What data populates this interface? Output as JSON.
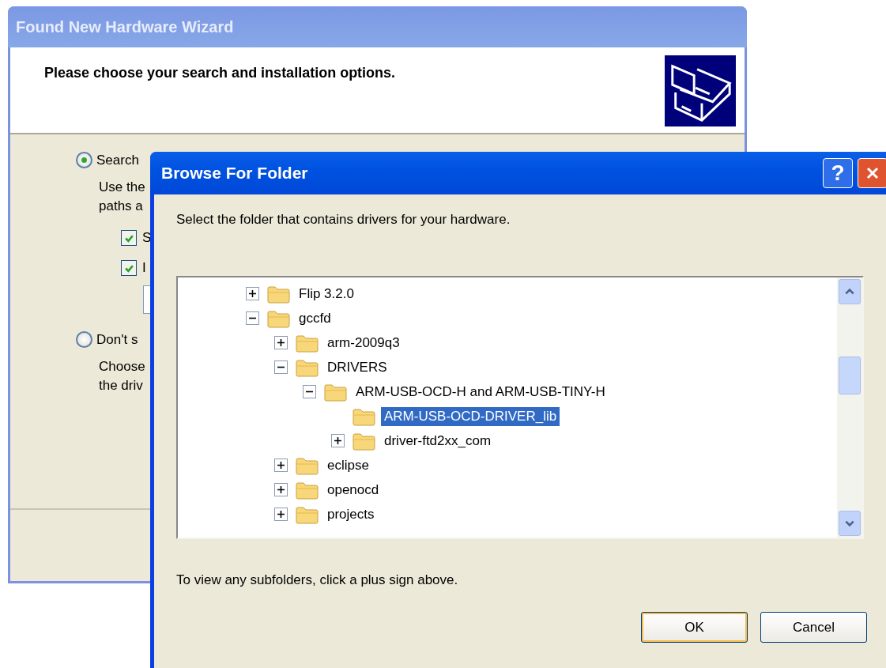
{
  "wizard": {
    "title": "Found New Hardware Wizard",
    "heading": "Please choose your search and installation options.",
    "options": [
      {
        "label": "Search",
        "selected": true,
        "description": [
          "Use the",
          "paths a"
        ],
        "checkboxes": [
          {
            "label": "S",
            "checked": true
          },
          {
            "label": "I",
            "checked": true
          }
        ]
      },
      {
        "label": "Don't s",
        "selected": false,
        "description": [
          "Choose",
          "the driv"
        ]
      }
    ]
  },
  "dialog": {
    "title": "Browse For Folder",
    "help_button": "?",
    "instruction": "Select the folder that contains drivers for your hardware.",
    "tree": {
      "items": [
        {
          "label": "Flip 3.2.0",
          "kind": "collapsed",
          "selected": false
        },
        {
          "label": "gccfd",
          "kind": "expanded",
          "selected": false,
          "children": [
            {
              "label": "arm-2009q3",
              "kind": "collapsed",
              "selected": false
            },
            {
              "label": "DRIVERS",
              "kind": "expanded",
              "selected": false,
              "children": [
                {
                  "label": "ARM-USB-OCD-H and ARM-USB-TINY-H",
                  "kind": "expanded",
                  "selected": false,
                  "children": [
                    {
                      "label": "ARM-USB-OCD-DRIVER_lib",
                      "kind": "leaf",
                      "selected": true
                    },
                    {
                      "label": "driver-ftd2xx_com",
                      "kind": "collapsed",
                      "selected": false
                    }
                  ]
                }
              ]
            },
            {
              "label": "eclipse",
              "kind": "collapsed",
              "selected": false
            },
            {
              "label": "openocd",
              "kind": "collapsed",
              "selected": false
            },
            {
              "label": "projects",
              "kind": "collapsed",
              "selected": false
            }
          ]
        }
      ]
    },
    "hint": "To view any subfolders, click a plus sign above.",
    "buttons": [
      {
        "label": "OK",
        "kind": "default"
      },
      {
        "label": "Cancel",
        "kind": "normal"
      }
    ]
  }
}
